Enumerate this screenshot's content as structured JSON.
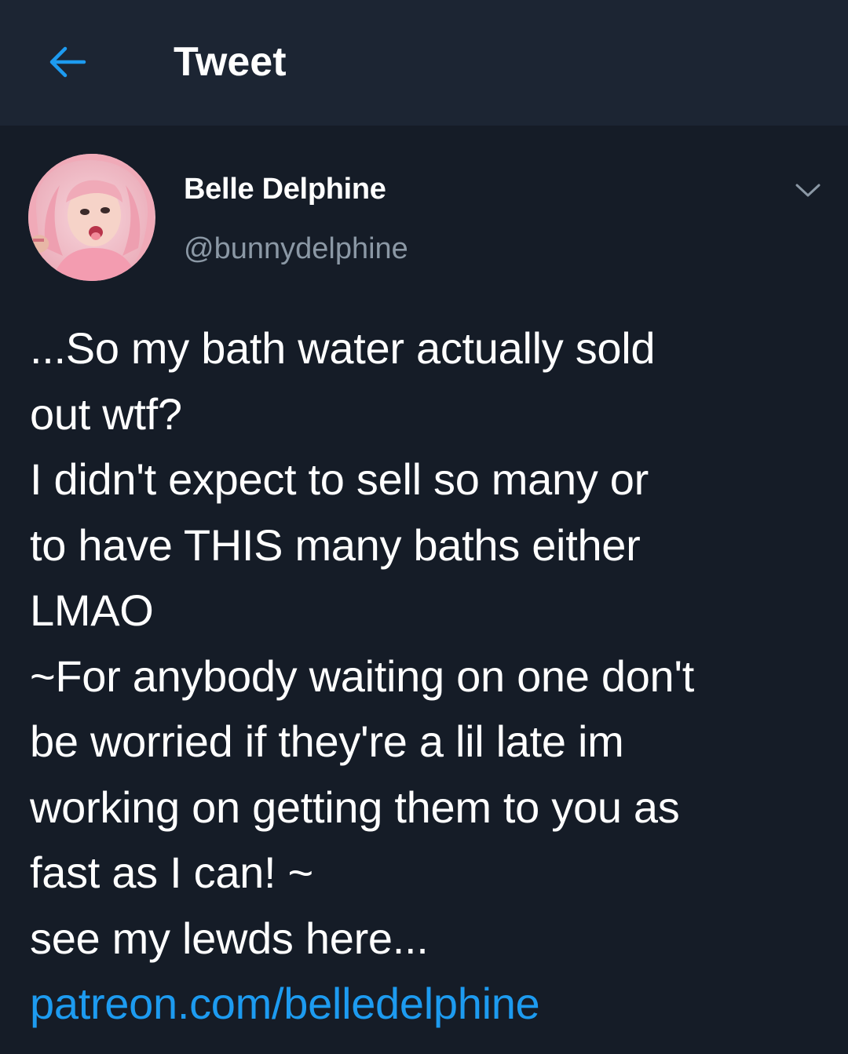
{
  "header": {
    "title": "Tweet",
    "back_icon": "arrow-left-icon",
    "accent_color": "#1d9bf0"
  },
  "tweet": {
    "author": {
      "name": "Belle Delphine",
      "handle": "@bunnydelphine"
    },
    "menu_icon": "chevron-down-icon",
    "lines": [
      "...So my bath water actually sold",
      "out wtf?",
      "I didn't expect to sell so many or",
      "to have THIS many baths either",
      "LMAO",
      "~For anybody waiting on one don't",
      "be worried if they're a lil late im",
      "working on getting them to you as",
      "fast as I can! ~",
      "see my lewds here..."
    ],
    "link": "patreon.com/belledelphine"
  },
  "colors": {
    "background": "#151c27",
    "header_background": "#1c2533",
    "secondary_text": "#8b98a5",
    "link": "#1d9bf0"
  }
}
